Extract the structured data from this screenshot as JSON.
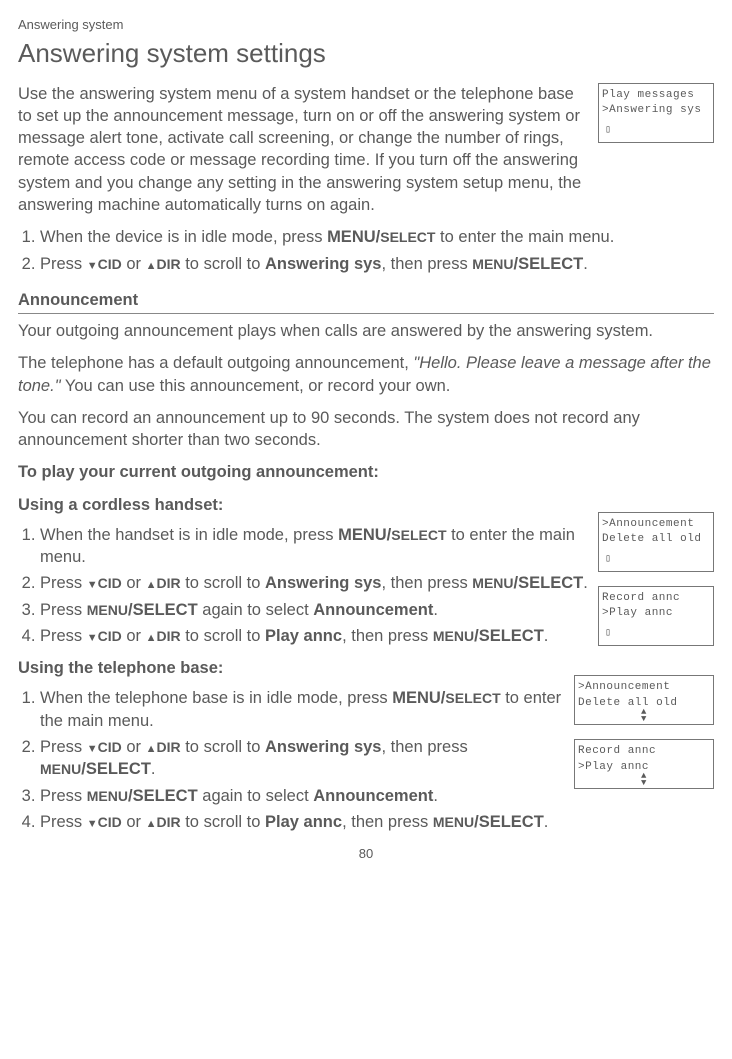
{
  "header": {
    "category": "Answering system",
    "title": "Answering system settings"
  },
  "intro": {
    "text": "Use the answering system menu of a system handset or the telephone base to set up the announcement message, turn on or off the answering system or message alert tone, activate call screening, or change the number of rings, remote access code or message recording time. If you turn off the answering system and you change any setting in the answering system setup menu, the answering machine automatically turns on again."
  },
  "screen1": {
    "line1": " Play messages",
    "line2": ">Answering sys"
  },
  "main_steps": {
    "step1_a": "When the device is in idle mode, press ",
    "step1_b": "MENU/",
    "step1_c": "SELECT",
    "step1_d": " to enter the main menu.",
    "step2_a": "Press ",
    "step2_cid": "CID",
    "step2_or": " or ",
    "step2_dir": "DIR",
    "step2_b": " to scroll to ",
    "step2_target": "Answering sys",
    "step2_c": ", then press ",
    "step2_menu": "MENU",
    "step2_select": "/SELECT",
    "step2_end": "."
  },
  "announcement": {
    "heading": "Announcement",
    "para1": "Your outgoing announcement plays when calls are answered by the answering system.",
    "para2_a": "The telephone has a default outgoing announcement, ",
    "para2_quote": "\"Hello. Please leave a message after the tone.\"",
    "para2_b": " You can use this announcement, or record your own.",
    "para3": "You can record an announcement up to 90 seconds. The system does not record any announcement shorter than two seconds.",
    "play_heading": "To play your current outgoing announcement:",
    "handset_heading": "Using a cordless handset:",
    "h_step1_a": "When the handset is in idle mode, press ",
    "h_step1_b": "MENU/",
    "h_step1_c": "SELECT",
    "h_step1_d": " to enter the main menu.",
    "h_step3_a": "Press ",
    "h_step3_menu": "MENU",
    "h_step3_select": "/SELECT",
    "h_step3_b": " again to select ",
    "h_step3_target": "Announcement",
    "h_step3_end": ".",
    "h_step4_target": "Play annc",
    "base_heading": "Using the telephone base:",
    "b_step1_a": "When the telephone base is in idle mode, press ",
    "b_step2_c": ", then press "
  },
  "screen2": {
    "line1": ">Announcement",
    "line2": " Delete all old"
  },
  "screen3": {
    "line1": " Record annc",
    "line2": ">Play annc"
  },
  "screen4": {
    "line1": ">Announcement",
    "line2": " Delete all old"
  },
  "screen5": {
    "line1": " Record annc",
    "line2": ">Play annc"
  },
  "page_number": "80"
}
